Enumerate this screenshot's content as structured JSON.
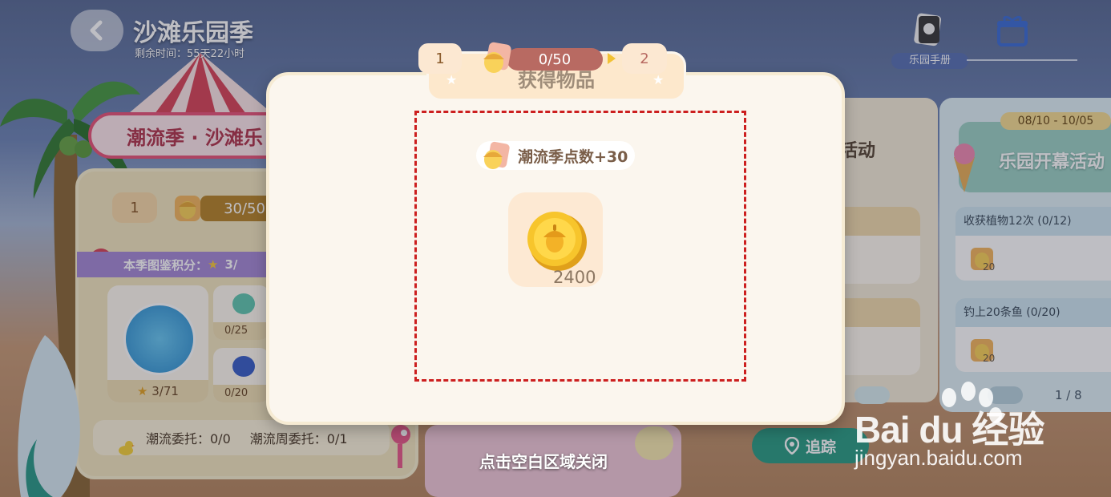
{
  "header": {
    "title": "沙滩乐园季",
    "remaining_time": "剩余时间：55天22小时"
  },
  "top_right": {
    "handbook_label": "乐园手册"
  },
  "left_panel": {
    "banner": "潮流季 · 沙滩乐",
    "level": "1",
    "progress": "30/50",
    "collection_label": "本季图鉴积分：",
    "collection_score": "3/",
    "card_big_count": "3/71",
    "card_small_1_count": "0/25",
    "card_small_2_count": "0/20",
    "commission": "潮流委托：0/0",
    "weekly_commission": "潮流周委托：0/1"
  },
  "mid_panel": {
    "activity_label": "活动"
  },
  "right_panel": {
    "date_range": "08/10 - 10/05",
    "activity_title": "乐园开幕活动",
    "tasks": [
      {
        "title": "收获植物12次 (0/12)",
        "reward": "20"
      },
      {
        "title": "钓上20条鱼 (0/20)",
        "reward": "20"
      }
    ],
    "page": "1 / 8"
  },
  "bottom": {
    "track_label": "追踪",
    "close_hint": "点击空白区域关闭"
  },
  "modal": {
    "title": "获得物品",
    "progress": {
      "current_level": "1",
      "progress_text": "0/50",
      "next_level": "2"
    },
    "points_chip": "潮流季点数+30",
    "item": {
      "icon": "acorn-coin-icon",
      "count": "2400"
    }
  },
  "watermark": {
    "brand": "Bai du 经验",
    "url": "jingyan.baidu.com"
  },
  "colors": {
    "modal_bg": "#fbf6ee",
    "highlight": "#cc1f1f",
    "track_button": "#2f9f86",
    "progress_fill": "#b86a62"
  }
}
